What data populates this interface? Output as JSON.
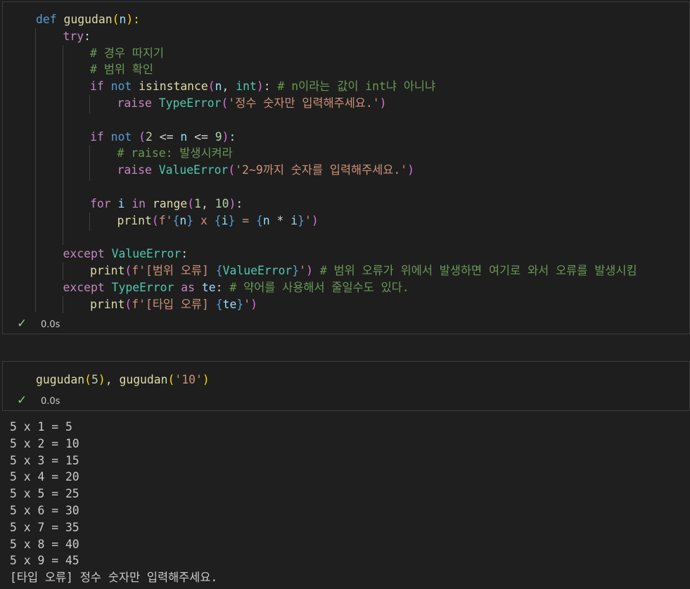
{
  "cell1": {
    "status": "0.0s",
    "lines": [
      [
        {
          "t": "def",
          "c": "kb"
        },
        {
          "t": " ",
          "c": "pl"
        },
        {
          "t": "gugudan",
          "c": "fn"
        },
        {
          "t": "(",
          "c": "br1"
        },
        {
          "t": "n",
          "c": "var"
        },
        {
          "t": "):",
          "c": "br1"
        }
      ],
      [
        {
          "t": "try",
          "c": "kw"
        },
        {
          "t": ":",
          "c": "pl"
        }
      ],
      [
        {
          "t": "# 경우 따지기",
          "c": "cm"
        }
      ],
      [
        {
          "t": "# 범위 확인",
          "c": "cm"
        }
      ],
      [
        {
          "t": "if",
          "c": "kw"
        },
        {
          "t": " ",
          "c": "pl"
        },
        {
          "t": "not",
          "c": "kb"
        },
        {
          "t": " ",
          "c": "pl"
        },
        {
          "t": "isinstance",
          "c": "fn"
        },
        {
          "t": "(",
          "c": "br2"
        },
        {
          "t": "n",
          "c": "var"
        },
        {
          "t": ", ",
          "c": "pl"
        },
        {
          "t": "int",
          "c": "cl"
        },
        {
          "t": ")",
          "c": "br2"
        },
        {
          "t": ": ",
          "c": "pl"
        },
        {
          "t": "# n이라는 값이 int냐 아니냐",
          "c": "cm"
        }
      ],
      [
        {
          "t": "raise",
          "c": "kw"
        },
        {
          "t": " ",
          "c": "pl"
        },
        {
          "t": "TypeError",
          "c": "cl"
        },
        {
          "t": "(",
          "c": "br2"
        },
        {
          "t": "'정수 숫자만 입력해주세요.'",
          "c": "str"
        },
        {
          "t": ")",
          "c": "br2"
        }
      ],
      [],
      [
        {
          "t": "if",
          "c": "kw"
        },
        {
          "t": " ",
          "c": "pl"
        },
        {
          "t": "not",
          "c": "kb"
        },
        {
          "t": " ",
          "c": "pl"
        },
        {
          "t": "(",
          "c": "br2"
        },
        {
          "t": "2",
          "c": "num"
        },
        {
          "t": " <= ",
          "c": "pl"
        },
        {
          "t": "n",
          "c": "var"
        },
        {
          "t": " <= ",
          "c": "pl"
        },
        {
          "t": "9",
          "c": "num"
        },
        {
          "t": ")",
          "c": "br2"
        },
        {
          "t": ":",
          "c": "pl"
        }
      ],
      [
        {
          "t": "# raise: 발생시켜라",
          "c": "cm"
        }
      ],
      [
        {
          "t": "raise",
          "c": "kw"
        },
        {
          "t": " ",
          "c": "pl"
        },
        {
          "t": "ValueError",
          "c": "cl"
        },
        {
          "t": "(",
          "c": "br2"
        },
        {
          "t": "'2~9까지 숫자를 입력해주세요.'",
          "c": "str"
        },
        {
          "t": ")",
          "c": "br2"
        }
      ],
      [],
      [
        {
          "t": "for",
          "c": "kw"
        },
        {
          "t": " ",
          "c": "pl"
        },
        {
          "t": "i",
          "c": "var"
        },
        {
          "t": " ",
          "c": "pl"
        },
        {
          "t": "in",
          "c": "kw"
        },
        {
          "t": " ",
          "c": "pl"
        },
        {
          "t": "range",
          "c": "fn"
        },
        {
          "t": "(",
          "c": "br2"
        },
        {
          "t": "1",
          "c": "num"
        },
        {
          "t": ", ",
          "c": "pl"
        },
        {
          "t": "10",
          "c": "num"
        },
        {
          "t": ")",
          "c": "br2"
        },
        {
          "t": ":",
          "c": "pl"
        }
      ],
      [
        {
          "t": "print",
          "c": "fn"
        },
        {
          "t": "(",
          "c": "br2"
        },
        {
          "t": "f'",
          "c": "str"
        },
        {
          "t": "{",
          "c": "kb"
        },
        {
          "t": "n",
          "c": "var"
        },
        {
          "t": "}",
          "c": "kb"
        },
        {
          "t": " x ",
          "c": "str"
        },
        {
          "t": "{",
          "c": "kb"
        },
        {
          "t": "i",
          "c": "var"
        },
        {
          "t": "}",
          "c": "kb"
        },
        {
          "t": " = ",
          "c": "str"
        },
        {
          "t": "{",
          "c": "kb"
        },
        {
          "t": "n",
          "c": "var"
        },
        {
          "t": " * ",
          "c": "pl"
        },
        {
          "t": "i",
          "c": "var"
        },
        {
          "t": "}",
          "c": "kb"
        },
        {
          "t": "'",
          "c": "str"
        },
        {
          "t": ")",
          "c": "br2"
        }
      ],
      [],
      [
        {
          "t": "except",
          "c": "kw"
        },
        {
          "t": " ",
          "c": "pl"
        },
        {
          "t": "ValueError",
          "c": "cl"
        },
        {
          "t": ":",
          "c": "pl"
        }
      ],
      [
        {
          "t": "print",
          "c": "fn"
        },
        {
          "t": "(",
          "c": "br2"
        },
        {
          "t": "f'[범위 오류] ",
          "c": "str"
        },
        {
          "t": "{",
          "c": "kb"
        },
        {
          "t": "ValueError",
          "c": "cl"
        },
        {
          "t": "}",
          "c": "kb"
        },
        {
          "t": "'",
          "c": "str"
        },
        {
          "t": ")",
          "c": "br2"
        },
        {
          "t": " ",
          "c": "pl"
        },
        {
          "t": "# 범위 오류가 위에서 발생하면 여기로 와서 오류를 발생시킴",
          "c": "cm"
        }
      ],
      [
        {
          "t": "except",
          "c": "kw"
        },
        {
          "t": " ",
          "c": "pl"
        },
        {
          "t": "TypeError",
          "c": "cl"
        },
        {
          "t": " ",
          "c": "pl"
        },
        {
          "t": "as",
          "c": "kw"
        },
        {
          "t": " ",
          "c": "pl"
        },
        {
          "t": "te",
          "c": "var"
        },
        {
          "t": ": ",
          "c": "pl"
        },
        {
          "t": "# 약어를 사용해서 줄일수도 있다.",
          "c": "cm"
        }
      ],
      [
        {
          "t": "print",
          "c": "fn"
        },
        {
          "t": "(",
          "c": "br2"
        },
        {
          "t": "f'[타입 오류] ",
          "c": "str"
        },
        {
          "t": "{",
          "c": "kb"
        },
        {
          "t": "te",
          "c": "var"
        },
        {
          "t": "}",
          "c": "kb"
        },
        {
          "t": "'",
          "c": "str"
        },
        {
          "t": ")",
          "c": "br2"
        }
      ]
    ]
  },
  "cell2": {
    "status": "0.0s",
    "lines": [
      [
        {
          "t": "gugudan",
          "c": "fn"
        },
        {
          "t": "(",
          "c": "br1"
        },
        {
          "t": "5",
          "c": "num"
        },
        {
          "t": ")",
          "c": "br1"
        },
        {
          "t": ", ",
          "c": "pl"
        },
        {
          "t": "gugudan",
          "c": "fn"
        },
        {
          "t": "(",
          "c": "br1"
        },
        {
          "t": "'10'",
          "c": "str"
        },
        {
          "t": ")",
          "c": "br1"
        }
      ]
    ]
  },
  "output": [
    "5 x 1 = 5",
    "5 x 2 = 10",
    "5 x 3 = 15",
    "5 x 4 = 20",
    "5 x 5 = 25",
    "5 x 6 = 30",
    "5 x 7 = 35",
    "5 x 8 = 40",
    "5 x 9 = 45",
    "[타입 오류] 정수 숫자만 입력해주세요."
  ],
  "icons": {
    "status_check": "check-icon"
  },
  "colors": {
    "check": "#89d185",
    "background": "#1e1e1e"
  }
}
